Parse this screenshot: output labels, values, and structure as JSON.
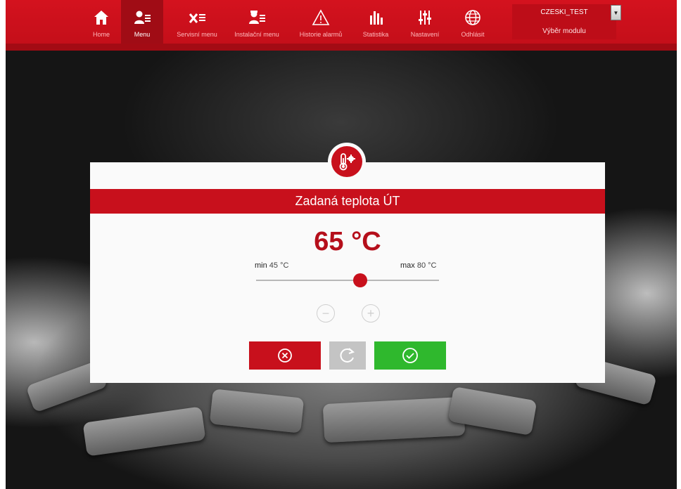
{
  "nav": {
    "items": [
      {
        "label": "Home",
        "icon": "home-icon"
      },
      {
        "label": "Menu",
        "icon": "user-menu-icon",
        "active": true
      },
      {
        "label": "Servisní menu",
        "icon": "tools-menu-icon"
      },
      {
        "label": "Instalační menu",
        "icon": "installer-menu-icon"
      },
      {
        "label": "Historie alarmů",
        "icon": "warning-icon"
      },
      {
        "label": "Statistika",
        "icon": "bar-chart-icon"
      },
      {
        "label": "Nastavení",
        "icon": "sliders-icon"
      },
      {
        "label": "Odhlásit",
        "icon": "globe-icon"
      }
    ],
    "module_select": {
      "value": "CZESKI_TEST",
      "label": "Výběr modulu"
    }
  },
  "dialog": {
    "icon": "thermometer-gear-icon",
    "title": "Zadaná teplota ÚT",
    "value": 65,
    "value_text": "65 °C",
    "min_label": "min",
    "min_value": "45 °C",
    "max_label": "max",
    "max_value": "80 °C",
    "slider_fraction": 0.57,
    "buttons": {
      "cancel_icon": "cancel-circle-icon",
      "reset_icon": "refresh-icon",
      "confirm_icon": "check-circle-icon"
    }
  },
  "colors": {
    "brand_red": "#c8101c",
    "confirm_green": "#2fb82d",
    "reset_gray": "#c4c4c4"
  }
}
